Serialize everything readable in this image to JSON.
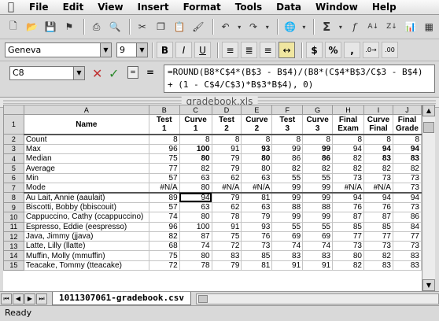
{
  "menubar": {
    "items": [
      "File",
      "Edit",
      "View",
      "Insert",
      "Format",
      "Tools",
      "Data",
      "Window",
      "Help"
    ]
  },
  "toolbar": {
    "font_name": "Geneva",
    "font_size": "9",
    "percent": "%",
    "dollar": "$",
    "comma": ",",
    "sum": "Σ",
    "bold": "B",
    "italic": "I",
    "underline": "U"
  },
  "formula_bar": {
    "cell_ref": "C8",
    "formula": "=ROUND(B8*C$4*(B$3 - B$4)/(B8*(C$4*B$3/C$3 - B$4) + (1 - C$4/C$3)*B$3*B$4), 0)"
  },
  "window": {
    "title": "gradebook.xls"
  },
  "sheet": {
    "tab_name": "1011307061-gradebook.csv",
    "columns": [
      "A",
      "B",
      "C",
      "D",
      "E",
      "F",
      "G",
      "H",
      "I",
      "J"
    ],
    "header": [
      "Name",
      "Test\n1",
      "Curve\n1",
      "Test\n2",
      "Curve\n2",
      "Test\n3",
      "Curve\n3",
      "Final\nExam",
      "Curve\nFinal",
      "Final\nGrade"
    ],
    "rows": [
      {
        "n": "2",
        "cells": [
          "Count",
          "8",
          "8",
          "8",
          "8",
          "8",
          "8",
          "8",
          "8",
          "8"
        ]
      },
      {
        "n": "3",
        "cells": [
          "Max",
          "96",
          "100",
          "91",
          "93",
          "99",
          "99",
          "94",
          "94",
          "94"
        ]
      },
      {
        "n": "4",
        "cells": [
          "Median",
          "75",
          "80",
          "79",
          "80",
          "86",
          "86",
          "82",
          "83",
          "83"
        ]
      },
      {
        "n": "5",
        "cells": [
          "Average",
          "77",
          "82",
          "79",
          "80",
          "82",
          "82",
          "82",
          "82",
          "82"
        ]
      },
      {
        "n": "6",
        "cells": [
          "Min",
          "57",
          "63",
          "62",
          "63",
          "55",
          "55",
          "73",
          "73",
          "73"
        ]
      },
      {
        "n": "7",
        "cells": [
          "Mode",
          "#N/A",
          "80",
          "#N/A",
          "#N/A",
          "99",
          "99",
          "#N/A",
          "#N/A",
          "73"
        ]
      },
      {
        "n": "8",
        "cells": [
          "Au Lait, Annie (aaulait)",
          "89",
          "94",
          "79",
          "81",
          "99",
          "99",
          "94",
          "94",
          "94"
        ]
      },
      {
        "n": "9",
        "cells": [
          "Biscotti, Bobby (bbiscouit)",
          "57",
          "63",
          "62",
          "63",
          "88",
          "88",
          "76",
          "76",
          "73"
        ]
      },
      {
        "n": "10",
        "cells": [
          "Cappuccino, Cathy (ccappuccino)",
          "74",
          "80",
          "78",
          "79",
          "99",
          "99",
          "87",
          "87",
          "86"
        ]
      },
      {
        "n": "11",
        "cells": [
          "Espresso, Eddie (eespresso)",
          "96",
          "100",
          "91",
          "93",
          "55",
          "55",
          "85",
          "85",
          "84"
        ]
      },
      {
        "n": "12",
        "cells": [
          "Java, Jimmy (jjava)",
          "82",
          "87",
          "75",
          "76",
          "69",
          "69",
          "77",
          "77",
          "77"
        ]
      },
      {
        "n": "13",
        "cells": [
          "Latte, Lilly (llatte)",
          "68",
          "74",
          "72",
          "73",
          "74",
          "74",
          "73",
          "73",
          "73"
        ]
      },
      {
        "n": "14",
        "cells": [
          "Muffin, Molly (mmuffin)",
          "75",
          "80",
          "83",
          "85",
          "83",
          "83",
          "80",
          "82",
          "83"
        ]
      },
      {
        "n": "15",
        "cells": [
          "Teacake, Tommy (tteacake)",
          "72",
          "78",
          "79",
          "81",
          "91",
          "91",
          "82",
          "83",
          "83"
        ]
      }
    ]
  },
  "status": {
    "text": "Ready"
  }
}
